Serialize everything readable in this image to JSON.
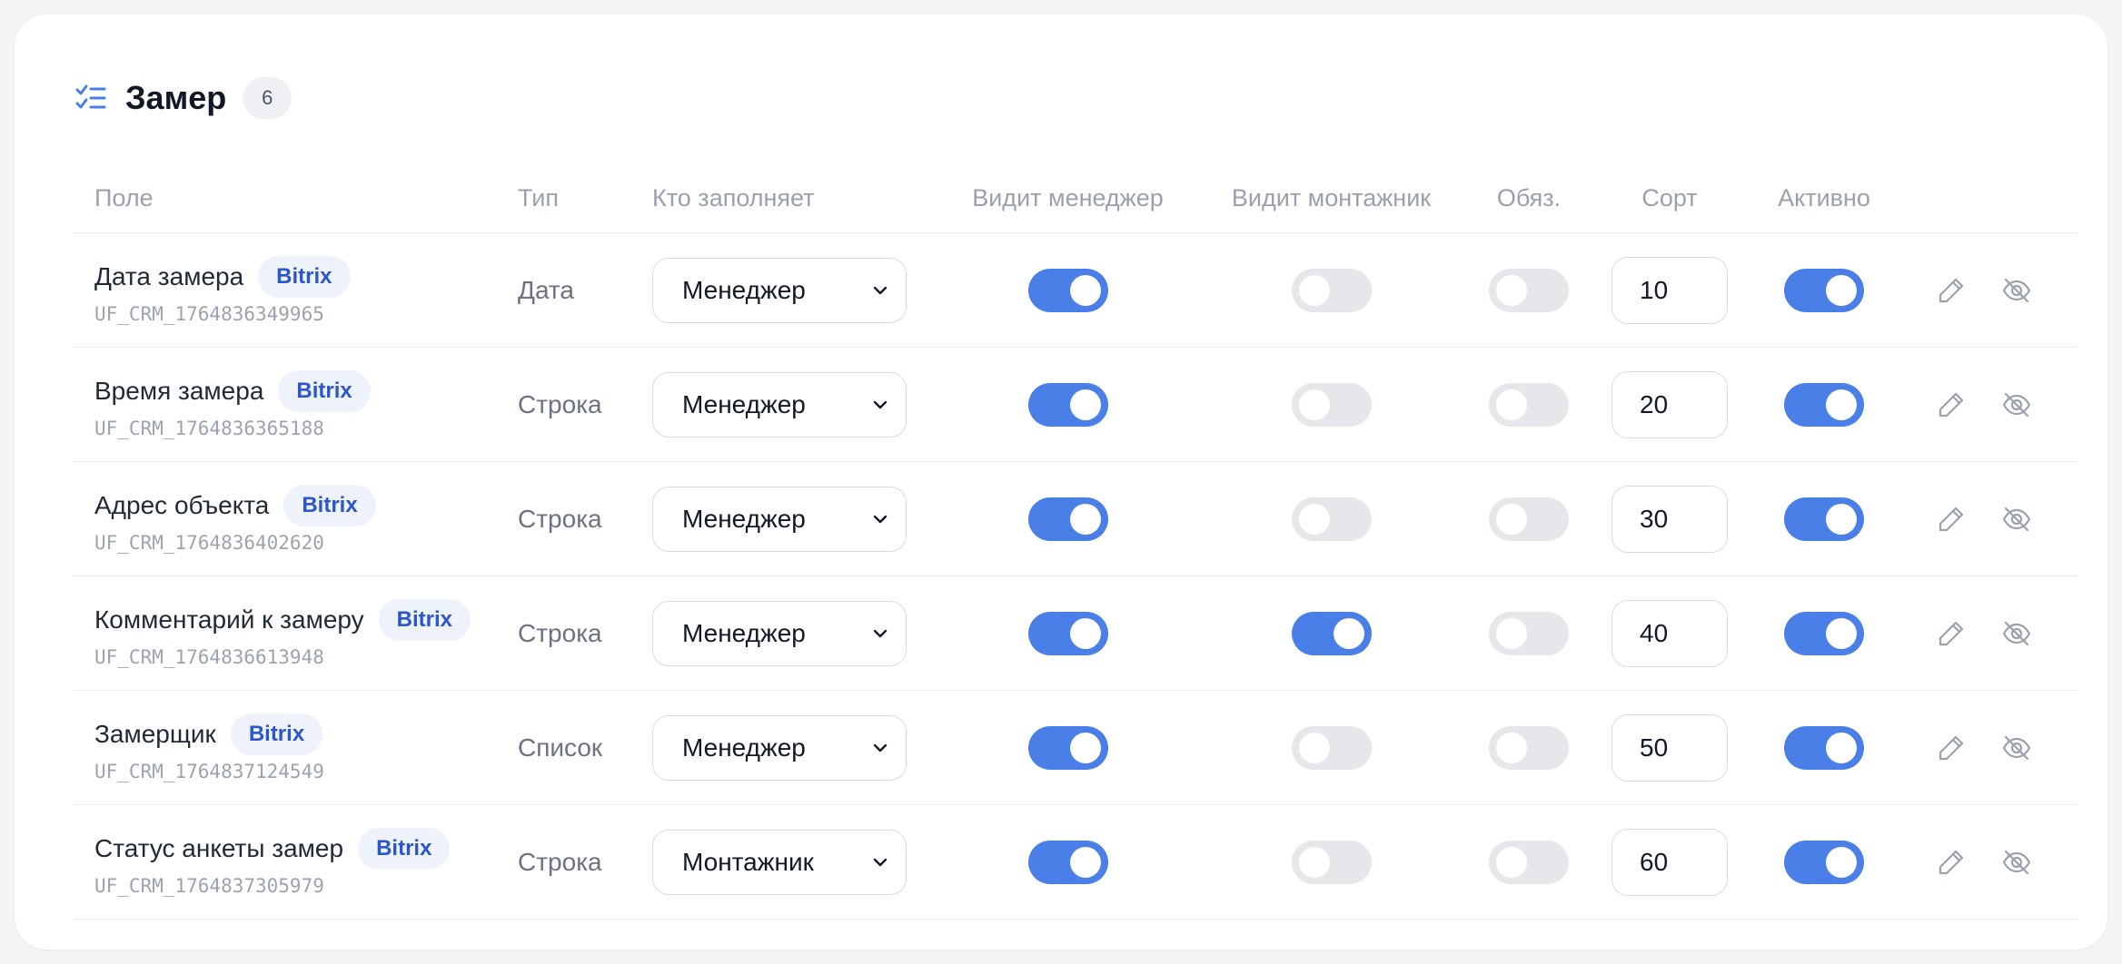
{
  "section": {
    "title": "Замер",
    "count": "6"
  },
  "columns": {
    "field": "Поле",
    "type": "Тип",
    "filler": "Кто заполняет",
    "manager": "Видит менеджер",
    "installer": "Видит монтажник",
    "required": "Обяз.",
    "sort": "Сорт",
    "active": "Активно"
  },
  "colors": {
    "accent": "#4a7fe8",
    "badge_text": "#2c56cc",
    "badge_bg": "#eef2fb",
    "toggle_off": "#e6e7ea"
  },
  "rows": [
    {
      "name": "Дата замера",
      "badge": "Bitrix",
      "code": "UF_CRM_1764836349965",
      "type": "Дата",
      "filler": "Менеджер",
      "manager": true,
      "installer": false,
      "required": false,
      "sort": "10",
      "active": true
    },
    {
      "name": "Время замера",
      "badge": "Bitrix",
      "code": "UF_CRM_1764836365188",
      "type": "Строка",
      "filler": "Менеджер",
      "manager": true,
      "installer": false,
      "required": false,
      "sort": "20",
      "active": true
    },
    {
      "name": "Адрес объекта",
      "badge": "Bitrix",
      "code": "UF_CRM_1764836402620",
      "type": "Строка",
      "filler": "Менеджер",
      "manager": true,
      "installer": false,
      "required": false,
      "sort": "30",
      "active": true
    },
    {
      "name": "Комментарий к замеру",
      "badge": "Bitrix",
      "code": "UF_CRM_1764836613948",
      "type": "Строка",
      "filler": "Менеджер",
      "manager": true,
      "installer": true,
      "required": false,
      "sort": "40",
      "active": true
    },
    {
      "name": "Замерщик",
      "badge": "Bitrix",
      "code": "UF_CRM_1764837124549",
      "type": "Список",
      "filler": "Менеджер",
      "manager": true,
      "installer": false,
      "required": false,
      "sort": "50",
      "active": true
    },
    {
      "name": "Статус анкеты замер",
      "badge": "Bitrix",
      "code": "UF_CRM_1764837305979",
      "type": "Строка",
      "filler": "Монтажник",
      "manager": true,
      "installer": false,
      "required": false,
      "sort": "60",
      "active": true
    }
  ]
}
